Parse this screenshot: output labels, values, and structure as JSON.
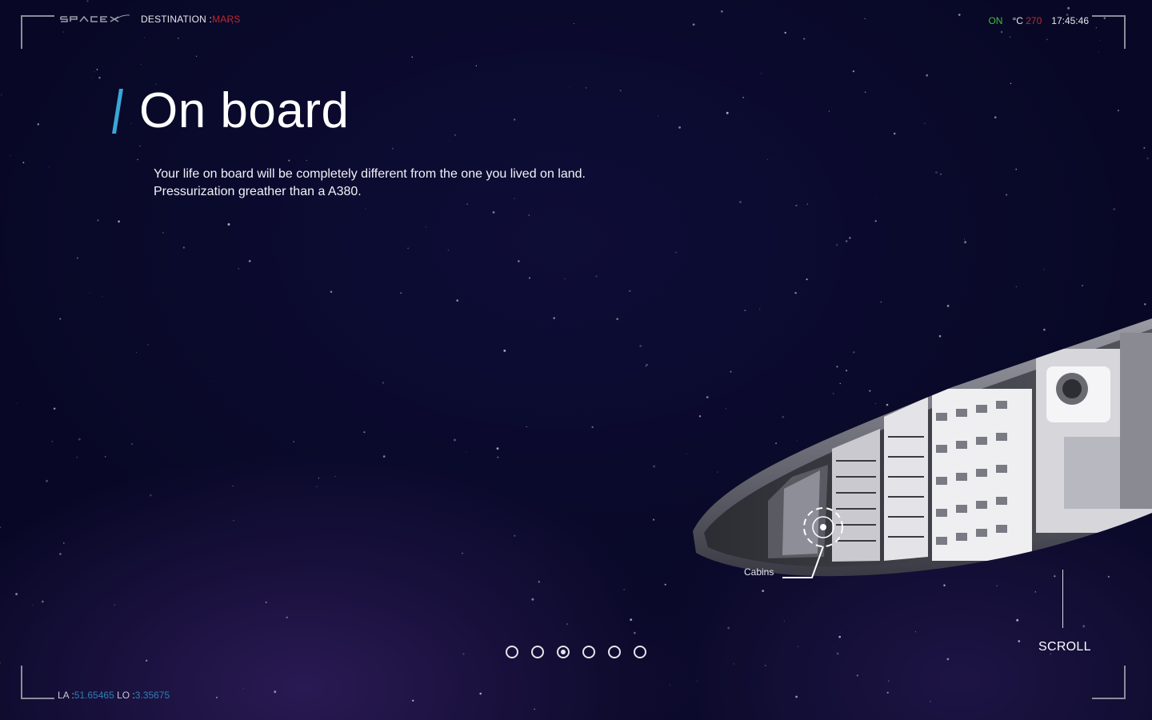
{
  "header": {
    "logo_icon": "spacex-logo",
    "destination_label": "DESTINATION :",
    "destination_value": "MARS",
    "status": "ON",
    "temp_unit": "°C",
    "temp_value": "270",
    "time": "17:45:46"
  },
  "hero": {
    "title": "On board",
    "description": "Your life on board will be completely different from the one you lived on land. Pressurization greather than a A380."
  },
  "ship": {
    "hotspot_label": "Cabins"
  },
  "pagination": {
    "count": 6,
    "active_index": 2
  },
  "scroll": {
    "label": "SCROLL"
  },
  "coords": {
    "la_label": "LA :",
    "la_value": "51.65465",
    "lo_label": "LO :",
    "lo_value": "3.35675"
  },
  "colors": {
    "accent_blue": "#3aa6d8",
    "accent_red": "#c0262d",
    "status_green": "#3fbf3a"
  }
}
